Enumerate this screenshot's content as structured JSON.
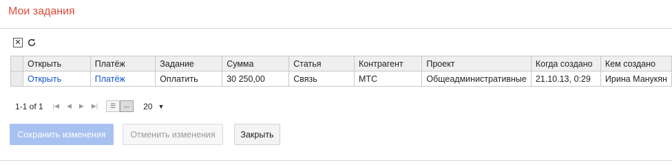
{
  "page": {
    "title": "Мои задания"
  },
  "toolbar": {
    "close_icon": "close-box-icon",
    "refresh_icon": "refresh-icon"
  },
  "table": {
    "columns": [
      "Открыть",
      "Платёж",
      "Задание",
      "Сумма",
      "Статья",
      "Контрагент",
      "Проект",
      "Когда создано",
      "Кем создано"
    ],
    "rows": [
      {
        "open": "Открыть",
        "payment": "Платёж",
        "task": "Оплатить",
        "amount": "30 250,00",
        "article": "Связь",
        "counterparty": "МТС",
        "project": "Общеадминистративные",
        "created_at": "21.10.13, 0:29",
        "created_by": "Ирина Манукян"
      }
    ]
  },
  "pager": {
    "range": "1-1 of 1",
    "page_size": "20"
  },
  "buttons": {
    "save": "Сохранить изменения",
    "cancel": "Отменить изменения",
    "close": "Закрыть"
  },
  "colors": {
    "title": "#dd4b39",
    "link": "#1155cc",
    "save_button": "#a7c1f0"
  }
}
